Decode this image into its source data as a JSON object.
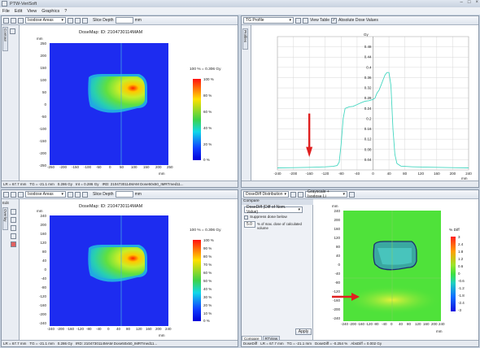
{
  "app": {
    "title": "PTW-VeriSoft",
    "menu": [
      "File",
      "Edit",
      "View",
      "Graphics",
      "?"
    ]
  },
  "tl": {
    "contour_tab": "Contour",
    "dropdown": "Isodose Areas",
    "slice_label": "Slice Depth",
    "slice_unit": "mm",
    "map_title": "DoseMap: ID: 2104730114MAM",
    "unit": "mm",
    "xticks": [
      "-250",
      "-200",
      "-150",
      "-100",
      "-50",
      "0",
      "50",
      "100",
      "150",
      "200",
      "250"
    ],
    "yticks": [
      "250",
      "200",
      "150",
      "100",
      "50",
      "0",
      "-50",
      "-100",
      "-150",
      "-200",
      "-250"
    ],
    "cbar_title": "100 % = 0.306 Gy",
    "cbar_ticks": [
      "100 %",
      "80 %",
      "60 %",
      "40 %",
      "20 %",
      "0 %"
    ],
    "status": [
      "LR = 67.7 mm",
      "TG = -21.1 mm",
      "0.286 Gy",
      "Int = 0.286 Gy",
      "IRD: 2104730114MAM Dose50x50_IMRTmed11..."
    ]
  },
  "tr": {
    "profile_select": "TG Profile",
    "view_table": "View Table",
    "abs_dose": "Absolute Dose Values",
    "unit": "Gy",
    "side_tab": "Profiles",
    "yticks": [
      "0.48",
      "0.44",
      "0.4",
      "0.36",
      "0.32",
      "0.28",
      "0.24",
      "0.2",
      "0.16",
      "0.12",
      "0.08",
      "0.04"
    ],
    "xticks": [
      "-240",
      "-200",
      "-160",
      "-120",
      "-80",
      "-40",
      "0",
      "40",
      "80",
      "120",
      "160",
      "200",
      "240"
    ],
    "xunit": "mm"
  },
  "bl": {
    "edit_tab": "Edit",
    "side_tab": "Overlay",
    "dropdown": "Isodose Areas",
    "slice_label": "Slice Depth",
    "slice_unit": "mm",
    "map_title": "DoseMap: ID: 2104730114MAM",
    "unit": "mm",
    "xticks": [
      "-240",
      "-200",
      "-160",
      "-120",
      "-80",
      "-40",
      "0",
      "40",
      "80",
      "120",
      "160",
      "200",
      "240"
    ],
    "yticks": [
      "240",
      "200",
      "160",
      "120",
      "80",
      "40",
      "0",
      "-40",
      "-80",
      "-120",
      "-160",
      "-200",
      "-240"
    ],
    "cbar_title": "100 % = 0.306 Gy",
    "cbar_ticks": [
      "100 %",
      "90 %",
      "80 %",
      "70 %",
      "60 %",
      "50 %",
      "40 %",
      "30 %",
      "20 %",
      "10 %",
      "0 %"
    ],
    "status": [
      "LR = 67.7 mm",
      "TG = -21.1 mm",
      "0.286 Gy",
      "IRD: 2104730114MAM Dose50x50_IMRTmed11..."
    ]
  },
  "br": {
    "analysis": "DoseDiff Distribution",
    "grayscale": "Grayscale + Isodose Li",
    "compare_hdr": "Compare",
    "compare_select": "DoseDiff (Diff of Nom. Value)",
    "suppress": "Suppress dose below",
    "pct_value": "5.0",
    "pct_text": "% of max. dose of calculated volume",
    "apply": "Apply",
    "tabs": [
      "Compare",
      "RTView"
    ],
    "cbar_title": "% Diff",
    "cbar_ticks": [
      "3",
      "2.4",
      "1.8",
      "1.2",
      "0.6",
      "0",
      "-0.6",
      "-1.2",
      "-1.8",
      "-2.4",
      "-3"
    ],
    "yticks": [
      "240",
      "200",
      "160",
      "120",
      "80",
      "40",
      "0",
      "-40",
      "-80",
      "-120",
      "-160",
      "-200",
      "-240"
    ],
    "xticks": [
      "-240",
      "-200",
      "-160",
      "-120",
      "-80",
      "-40",
      "0",
      "40",
      "80",
      "120",
      "160",
      "200",
      "240"
    ],
    "unit": "mm",
    "status": [
      "DoseDiff",
      "LR = 67.7 mm",
      "TG = -21.1 mm",
      "DoseDiff = -0.254 %",
      "AbsDiff = 0.002 Gy"
    ]
  },
  "colors": {
    "profile": "#44d6c0",
    "arrow": "#e02020",
    "accent": "#7a8696"
  },
  "chart_data": {
    "type": "line",
    "xlabel": "mm",
    "ylabel": "Gy",
    "xlim": [
      -240,
      240
    ],
    "ylim": [
      0,
      0.52
    ],
    "x": [
      -240,
      -200,
      -160,
      -120,
      -100,
      -90,
      -85,
      -80,
      -75,
      -70,
      -60,
      -50,
      -40,
      -30,
      -20,
      -10,
      0,
      5,
      10,
      15,
      20,
      25,
      30,
      35,
      40,
      45,
      50,
      55,
      60,
      70,
      100,
      160,
      200,
      240
    ],
    "series": [
      {
        "values": [
          0.008,
          0.009,
          0.01,
          0.012,
          0.014,
          0.017,
          0.03,
          0.1,
          0.2,
          0.24,
          0.246,
          0.248,
          0.255,
          0.262,
          0.268,
          0.27,
          0.275,
          0.28,
          0.3,
          0.31,
          0.33,
          0.35,
          0.37,
          0.38,
          0.38,
          0.33,
          0.16,
          0.06,
          0.025,
          0.015,
          0.012,
          0.01,
          0.009,
          0.008
        ]
      }
    ]
  }
}
